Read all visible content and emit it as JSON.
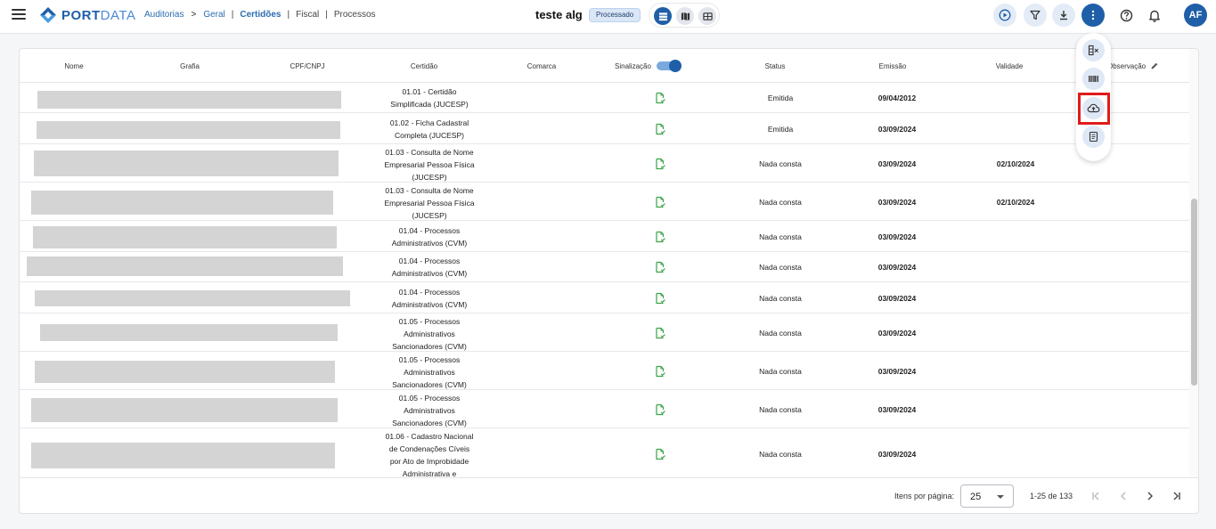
{
  "header": {
    "logo_text_bold": "PORT",
    "logo_text_light": "DATA",
    "breadcrumb": {
      "root": "Auditorias",
      "gt": ">",
      "items": [
        "Geral",
        "Certidões",
        "Fiscal",
        "Processos"
      ],
      "sep": "|"
    },
    "audit_title": "teste alg",
    "status_chip": "Processado",
    "avatar_initials": "AF",
    "icons": [
      "menu-icon",
      "play-circle-icon",
      "filter-icon",
      "download-icon",
      "more-vertical-icon",
      "help-icon",
      "bell-icon"
    ]
  },
  "view_toggle": {
    "icons": [
      "table-rows-icon",
      "map-icon",
      "grid-icon"
    ],
    "active": 0
  },
  "table": {
    "columns": {
      "nome": "Nome",
      "grafia": "Grafia",
      "cpf_cnpj": "CPF/CNPJ",
      "certidao": "Certidão",
      "comarca": "Comarca",
      "sinalizacao": "Sinalização",
      "status": "Status",
      "emissao": "Emissão",
      "validade": "Validade",
      "observacao": "Observação"
    },
    "sinalizacao_enabled": true,
    "rows": [
      {
        "certidao": [
          "01.01 - Certidão",
          "Simplificada (JUCESP)"
        ],
        "status": "Emitida",
        "emissao": "09/04/2012",
        "validade": ""
      },
      {
        "certidao": [
          "01.02 - Ficha Cadastral",
          "Completa (JUCESP)"
        ],
        "status": "Emitida",
        "emissao": "03/09/2024",
        "validade": ""
      },
      {
        "certidao": [
          "01.03 - Consulta de Nome",
          "Empresarial Pessoa Física",
          "(JUCESP)"
        ],
        "status": "Nada consta",
        "emissao": "03/09/2024",
        "validade": "02/10/2024"
      },
      {
        "certidao": [
          "01.03 - Consulta de Nome",
          "Empresarial Pessoa Física",
          "(JUCESP)"
        ],
        "status": "Nada consta",
        "emissao": "03/09/2024",
        "validade": "02/10/2024"
      },
      {
        "certidao": [
          "01.04 - Processos",
          "Administrativos (CVM)"
        ],
        "status": "Nada consta",
        "emissao": "03/09/2024",
        "validade": ""
      },
      {
        "certidao": [
          "01.04 - Processos",
          "Administrativos (CVM)"
        ],
        "status": "Nada consta",
        "emissao": "03/09/2024",
        "validade": ""
      },
      {
        "certidao": [
          "01.04 - Processos",
          "Administrativos (CVM)"
        ],
        "status": "Nada consta",
        "emissao": "03/09/2024",
        "validade": ""
      },
      {
        "certidao": [
          "01.05 - Processos",
          "Administrativos",
          "Sancionadores (CVM)"
        ],
        "status": "Nada consta",
        "emissao": "03/09/2024",
        "validade": ""
      },
      {
        "certidao": [
          "01.05 - Processos",
          "Administrativos",
          "Sancionadores (CVM)"
        ],
        "status": "Nada consta",
        "emissao": "03/09/2024",
        "validade": ""
      },
      {
        "certidao": [
          "01.05 - Processos",
          "Administrativos",
          "Sancionadores (CVM)"
        ],
        "status": "Nada consta",
        "emissao": "03/09/2024",
        "validade": ""
      },
      {
        "certidao": [
          "01.06 - Cadastro Nacional",
          "de Condenações Cíveis",
          "por Ato de Improbidade",
          "Administrativa e"
        ],
        "status": "Nada consta",
        "emissao": "03/09/2024",
        "validade": ""
      }
    ]
  },
  "pagination": {
    "items_per_page_label": "Itens por página:",
    "items_per_page": "25",
    "range": "1-25 de 133"
  },
  "floating_menu": {
    "icons": [
      "column-remove-icon",
      "barcode-icon",
      "cloud-upload-icon",
      "document-list-icon"
    ],
    "highlighted_index": 2
  },
  "colors": {
    "primary": "#1f5fa8",
    "chip_bg": "#dbe7f6",
    "doc_icon": "#3aa447",
    "highlight": "#e01b1b",
    "redacted": "#d4d4d4"
  }
}
